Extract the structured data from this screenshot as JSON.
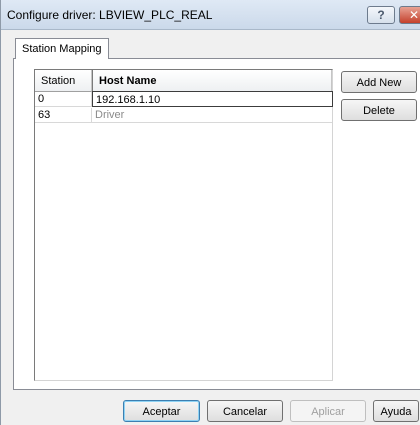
{
  "window": {
    "title": "Configure driver: LBVIEW_PLC_REAL",
    "help_glyph": "?",
    "close_glyph": "✕"
  },
  "tabs": [
    {
      "label": "Station Mapping",
      "active": true
    }
  ],
  "grid": {
    "columns": [
      "Station",
      "Host Name"
    ],
    "rows": [
      {
        "station": "0",
        "host": "192.168.1.10",
        "editing": true
      },
      {
        "station": "63",
        "host": "Driver",
        "editing": false
      }
    ]
  },
  "side_buttons": {
    "add_new": "Add New",
    "delete": "Delete"
  },
  "footer_buttons": {
    "accept": "Aceptar",
    "cancel": "Cancelar",
    "apply": "Aplicar",
    "help": "Ayuda"
  },
  "colors": {
    "titlebar": "#cbd9ea",
    "close_button": "#c4412c",
    "dialog_bg": "#f0f0f0"
  }
}
